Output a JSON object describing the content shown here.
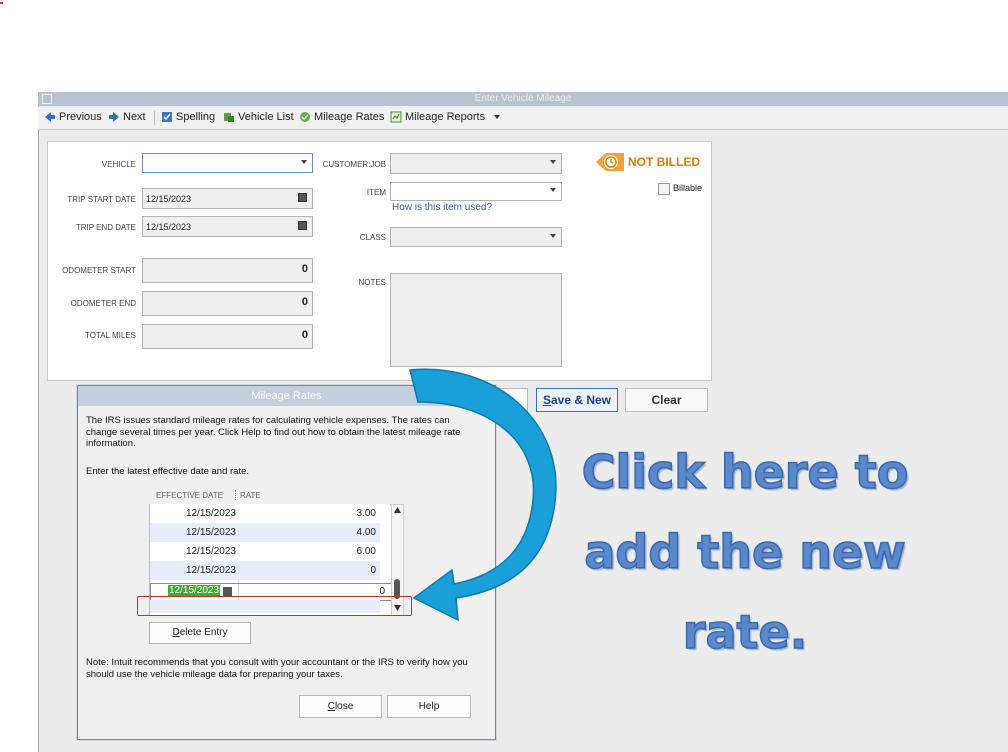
{
  "window": {
    "title": "Enter Vehicle Mileage"
  },
  "toolbar": {
    "previous": "Previous",
    "next": "Next",
    "spelling": "Spelling",
    "vehicle_list": "Vehicle List",
    "mileage_rates": "Mileage Rates",
    "mileage_reports": "Mileage Reports"
  },
  "form": {
    "vehicle_label": "VEHICLE",
    "vehicle_value": "",
    "trip_start_label": "TRIP START DATE",
    "trip_start_value": "12/15/2023",
    "trip_end_label": "TRIP END DATE",
    "trip_end_value": "12/15/2023",
    "odometer_start_label": "ODOMETER START",
    "odometer_start_value": "0",
    "odometer_end_label": "ODOMETER END",
    "odometer_end_value": "0",
    "total_miles_label": "TOTAL MILES",
    "total_miles_value": "0",
    "customer_job_label": "CUSTOMER:JOB",
    "item_label": "ITEM",
    "item_help_link": "How is this item used?",
    "class_label": "CLASS",
    "notes_label": "NOTES",
    "status": "NOT BILLED",
    "billable_label": "Billable",
    "billable_checked": false,
    "status_color": "#e07a00"
  },
  "buttons": {
    "save_close_partial": "e",
    "save_new": "Save & New",
    "save_new_underline": "S",
    "save_new_rest": "ave & New",
    "clear": "Clear"
  },
  "dialog": {
    "title": "Mileage Rates",
    "intro": "The IRS issues standard mileage rates for calculating vehicle expenses.  The rates can change several times per year.  Click Help to find out how to obtain the latest mileage rate information.",
    "instruction": "Enter the latest effective date and rate.",
    "col_date": "EFFECTIVE DATE",
    "col_rate": "RATE",
    "rows": [
      {
        "date": "12/15/2023",
        "rate": "3.00"
      },
      {
        "date": "12/15/2023",
        "rate": "4.00"
      },
      {
        "date": "12/15/2023",
        "rate": "6.00"
      },
      {
        "date": "12/15/2023",
        "rate": "0"
      }
    ],
    "edit_row": {
      "date": "12/15/2023",
      "rate": "0"
    },
    "delete_u": "D",
    "delete_rest": "elete Entry",
    "note": "Note: Intuit recommends that you consult with your accountant or the IRS to verify how you should use the vehicle mileage data for preparing your taxes.",
    "close_u": "C",
    "close_rest": "lose",
    "help": "Help"
  },
  "callout": {
    "line1": "Click here to",
    "line2": "add the new",
    "line3": "rate.",
    "arrow_color": "#1aa0d8"
  }
}
